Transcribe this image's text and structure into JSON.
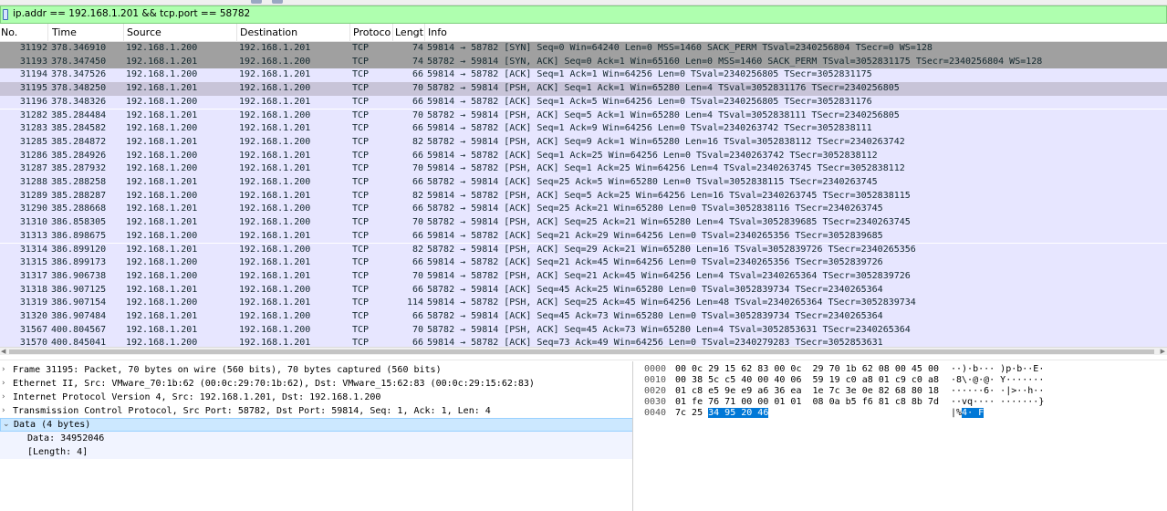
{
  "filter": {
    "expression": "ip.addr == 192.168.1.201 && tcp.port == 58782"
  },
  "columns": {
    "no": "No.",
    "time": "Time",
    "source": "Source",
    "destination": "Destination",
    "protocol": "Protoco",
    "length": "Lengt",
    "info": "Info"
  },
  "packets": [
    {
      "no": "31192",
      "time": "378.346910",
      "src": "192.168.1.200",
      "dst": "192.168.1.201",
      "proto": "TCP",
      "len": "74",
      "info": "59814 → 58782 [SYN] Seq=0 Win=64240 Len=0 MSS=1460 SACK_PERM TSval=2340256804 TSecr=0 WS=128",
      "style": "syn"
    },
    {
      "no": "31193",
      "time": "378.347450",
      "src": "192.168.1.201",
      "dst": "192.168.1.200",
      "proto": "TCP",
      "len": "74",
      "info": "58782 → 59814 [SYN, ACK] Seq=0 Ack=1 Win=65160 Len=0 MSS=1460 SACK_PERM TSval=3052831175 TSecr=2340256804 WS=128",
      "style": "syn"
    },
    {
      "no": "31194",
      "time": "378.347526",
      "src": "192.168.1.200",
      "dst": "192.168.1.201",
      "proto": "TCP",
      "len": "66",
      "info": "59814 → 58782 [ACK] Seq=1 Ack=1 Win=64256 Len=0 TSval=2340256805 TSecr=3052831175",
      "style": "normal"
    },
    {
      "no": "31195",
      "time": "378.348250",
      "src": "192.168.1.201",
      "dst": "192.168.1.200",
      "proto": "TCP",
      "len": "70",
      "info": "58782 → 59814 [PSH, ACK] Seq=1 Ack=1 Win=65280 Len=4 TSval=3052831176 TSecr=2340256805",
      "style": "sel"
    },
    {
      "no": "31196",
      "time": "378.348326",
      "src": "192.168.1.200",
      "dst": "192.168.1.201",
      "proto": "TCP",
      "len": "66",
      "info": "59814 → 58782 [ACK] Seq=1 Ack=5 Win=64256 Len=0 TSval=2340256805 TSecr=3052831176",
      "style": "normal"
    },
    {
      "no": "31282",
      "time": "385.284484",
      "src": "192.168.1.201",
      "dst": "192.168.1.200",
      "proto": "TCP",
      "len": "70",
      "info": "58782 → 59814 [PSH, ACK] Seq=5 Ack=1 Win=65280 Len=4 TSval=3052838111 TSecr=2340256805",
      "style": "normal"
    },
    {
      "no": "31283",
      "time": "385.284582",
      "src": "192.168.1.200",
      "dst": "192.168.1.201",
      "proto": "TCP",
      "len": "66",
      "info": "59814 → 58782 [ACK] Seq=1 Ack=9 Win=64256 Len=0 TSval=2340263742 TSecr=3052838111",
      "style": "normal"
    },
    {
      "no": "31285",
      "time": "385.284872",
      "src": "192.168.1.201",
      "dst": "192.168.1.200",
      "proto": "TCP",
      "len": "82",
      "info": "58782 → 59814 [PSH, ACK] Seq=9 Ack=1 Win=65280 Len=16 TSval=3052838112 TSecr=2340263742",
      "style": "normal"
    },
    {
      "no": "31286",
      "time": "385.284926",
      "src": "192.168.1.200",
      "dst": "192.168.1.201",
      "proto": "TCP",
      "len": "66",
      "info": "59814 → 58782 [ACK] Seq=1 Ack=25 Win=64256 Len=0 TSval=2340263742 TSecr=3052838112",
      "style": "normal"
    },
    {
      "no": "31287",
      "time": "385.287932",
      "src": "192.168.1.200",
      "dst": "192.168.1.201",
      "proto": "TCP",
      "len": "70",
      "info": "59814 → 58782 [PSH, ACK] Seq=1 Ack=25 Win=64256 Len=4 TSval=2340263745 TSecr=3052838112",
      "style": "normal"
    },
    {
      "no": "31288",
      "time": "385.288258",
      "src": "192.168.1.201",
      "dst": "192.168.1.200",
      "proto": "TCP",
      "len": "66",
      "info": "58782 → 59814 [ACK] Seq=25 Ack=5 Win=65280 Len=0 TSval=3052838115 TSecr=2340263745",
      "style": "normal"
    },
    {
      "no": "31289",
      "time": "385.288287",
      "src": "192.168.1.200",
      "dst": "192.168.1.201",
      "proto": "TCP",
      "len": "82",
      "info": "59814 → 58782 [PSH, ACK] Seq=5 Ack=25 Win=64256 Len=16 TSval=2340263745 TSecr=3052838115",
      "style": "normal"
    },
    {
      "no": "31290",
      "time": "385.288668",
      "src": "192.168.1.201",
      "dst": "192.168.1.200",
      "proto": "TCP",
      "len": "66",
      "info": "58782 → 59814 [ACK] Seq=25 Ack=21 Win=65280 Len=0 TSval=3052838116 TSecr=2340263745",
      "style": "normal"
    },
    {
      "no": "31310",
      "time": "386.858305",
      "src": "192.168.1.201",
      "dst": "192.168.1.200",
      "proto": "TCP",
      "len": "70",
      "info": "58782 → 59814 [PSH, ACK] Seq=25 Ack=21 Win=65280 Len=4 TSval=3052839685 TSecr=2340263745",
      "style": "normal"
    },
    {
      "no": "31313",
      "time": "386.898675",
      "src": "192.168.1.200",
      "dst": "192.168.1.201",
      "proto": "TCP",
      "len": "66",
      "info": "59814 → 58782 [ACK] Seq=21 Ack=29 Win=64256 Len=0 TSval=2340265356 TSecr=3052839685",
      "style": "normal"
    },
    {
      "no": "31314",
      "time": "386.899120",
      "src": "192.168.1.201",
      "dst": "192.168.1.200",
      "proto": "TCP",
      "len": "82",
      "info": "58782 → 59814 [PSH, ACK] Seq=29 Ack=21 Win=65280 Len=16 TSval=3052839726 TSecr=2340265356",
      "style": "normal"
    },
    {
      "no": "31315",
      "time": "386.899173",
      "src": "192.168.1.200",
      "dst": "192.168.1.201",
      "proto": "TCP",
      "len": "66",
      "info": "59814 → 58782 [ACK] Seq=21 Ack=45 Win=64256 Len=0 TSval=2340265356 TSecr=3052839726",
      "style": "normal"
    },
    {
      "no": "31317",
      "time": "386.906738",
      "src": "192.168.1.200",
      "dst": "192.168.1.201",
      "proto": "TCP",
      "len": "70",
      "info": "59814 → 58782 [PSH, ACK] Seq=21 Ack=45 Win=64256 Len=4 TSval=2340265364 TSecr=3052839726",
      "style": "normal"
    },
    {
      "no": "31318",
      "time": "386.907125",
      "src": "192.168.1.201",
      "dst": "192.168.1.200",
      "proto": "TCP",
      "len": "66",
      "info": "58782 → 59814 [ACK] Seq=45 Ack=25 Win=65280 Len=0 TSval=3052839734 TSecr=2340265364",
      "style": "normal"
    },
    {
      "no": "31319",
      "time": "386.907154",
      "src": "192.168.1.200",
      "dst": "192.168.1.201",
      "proto": "TCP",
      "len": "114",
      "info": "59814 → 58782 [PSH, ACK] Seq=25 Ack=45 Win=64256 Len=48 TSval=2340265364 TSecr=3052839734",
      "style": "normal"
    },
    {
      "no": "31320",
      "time": "386.907484",
      "src": "192.168.1.201",
      "dst": "192.168.1.200",
      "proto": "TCP",
      "len": "66",
      "info": "58782 → 59814 [ACK] Seq=45 Ack=73 Win=65280 Len=0 TSval=3052839734 TSecr=2340265364",
      "style": "normal"
    },
    {
      "no": "31567",
      "time": "400.804567",
      "src": "192.168.1.201",
      "dst": "192.168.1.200",
      "proto": "TCP",
      "len": "70",
      "info": "58782 → 59814 [PSH, ACK] Seq=45 Ack=73 Win=65280 Len=4 TSval=3052853631 TSecr=2340265364",
      "style": "normal"
    },
    {
      "no": "31570",
      "time": "400.845041",
      "src": "192.168.1.200",
      "dst": "192.168.1.201",
      "proto": "TCP",
      "len": "66",
      "info": "59814 → 58782 [ACK] Seq=73 Ack=49 Win=64256 Len=0 TSval=2340279283 TSecr=3052853631",
      "style": "normal"
    }
  ],
  "details": [
    {
      "text": "Frame 31195: Packet, 70 bytes on wire (560 bits), 70 bytes captured (560 bits)",
      "arrow": "›",
      "kind": "top"
    },
    {
      "text": "Ethernet II, Src: VMware_70:1b:62 (00:0c:29:70:1b:62), Dst: VMware_15:62:83 (00:0c:29:15:62:83)",
      "arrow": "›",
      "kind": "top"
    },
    {
      "text": "Internet Protocol Version 4, Src: 192.168.1.201, Dst: 192.168.1.200",
      "arrow": "›",
      "kind": "top"
    },
    {
      "text": "Transmission Control Protocol, Src Port: 58782, Dst Port: 59814, Seq: 1, Ack: 1, Len: 4",
      "arrow": "›",
      "kind": "top"
    },
    {
      "text": "Data (4 bytes)",
      "arrow": "⌄",
      "kind": "sel"
    },
    {
      "text": "Data: 34952046",
      "arrow": "",
      "kind": "child"
    },
    {
      "text": "[Length: 4]",
      "arrow": "",
      "kind": "child"
    }
  ],
  "bytes": [
    {
      "offset": "0000",
      "hex": "00 0c 29 15 62 83 00 0c  29 70 1b 62 08 00 45 00",
      "ascii": "··)·b··· )p·b··E·",
      "hl_hex": "",
      "hl_ascii": ""
    },
    {
      "offset": "0010",
      "hex": "00 38 5c c5 40 00 40 06  59 19 c0 a8 01 c9 c0 a8",
      "ascii": "·8\\·@·@· Y·······",
      "hl_hex": "",
      "hl_ascii": ""
    },
    {
      "offset": "0020",
      "hex": "01 c8 e5 9e e9 a6 36 ea  1e 7c 3e 0e 82 68 80 18",
      "ascii": "······6· ·|>··h··",
      "hl_hex": "",
      "hl_ascii": ""
    },
    {
      "offset": "0030",
      "hex": "01 fe 76 71 00 00 01 01  08 0a b5 f6 81 c8 8b 7d",
      "ascii": "··vq···· ·······}",
      "hl_hex": "",
      "hl_ascii": ""
    },
    {
      "offset": "0040",
      "hex": "7c 25 ",
      "ascii": "|%",
      "hl_hex": "34 95 20 46",
      "hl_ascii": "4· F"
    }
  ]
}
